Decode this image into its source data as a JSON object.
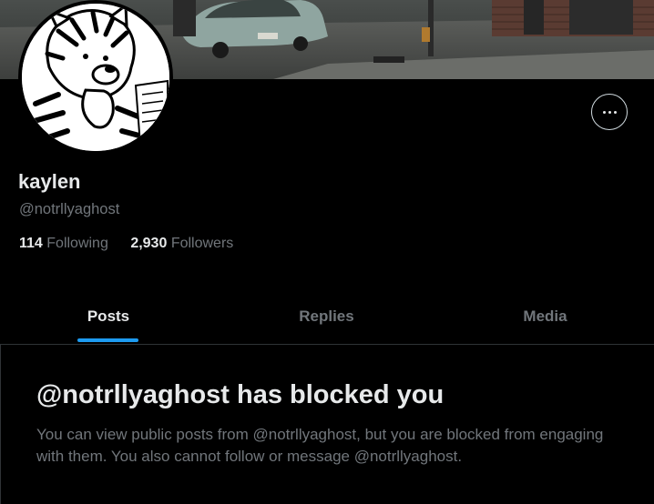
{
  "profile": {
    "name": "kaylen",
    "handle": "@notrllyaghost",
    "following_count": "114",
    "following_label": "Following",
    "followers_count": "2,930",
    "followers_label": "Followers"
  },
  "tabs": [
    {
      "label": "Posts",
      "active": true
    },
    {
      "label": "Replies",
      "active": false
    },
    {
      "label": "Media",
      "active": false
    }
  ],
  "blocked": {
    "title": "@notrllyaghost has blocked you",
    "body": "You can view public posts from @notrllyaghost, but you are blocked from engaging with them. You also cannot follow or message @notrllyaghost."
  },
  "icons": {
    "more": "more-horizontal-icon"
  },
  "colors": {
    "background": "#000000",
    "primary_text": "#e7e9ea",
    "secondary_text": "#71767b",
    "accent": "#1d9bf0",
    "border": "#2f3336"
  }
}
